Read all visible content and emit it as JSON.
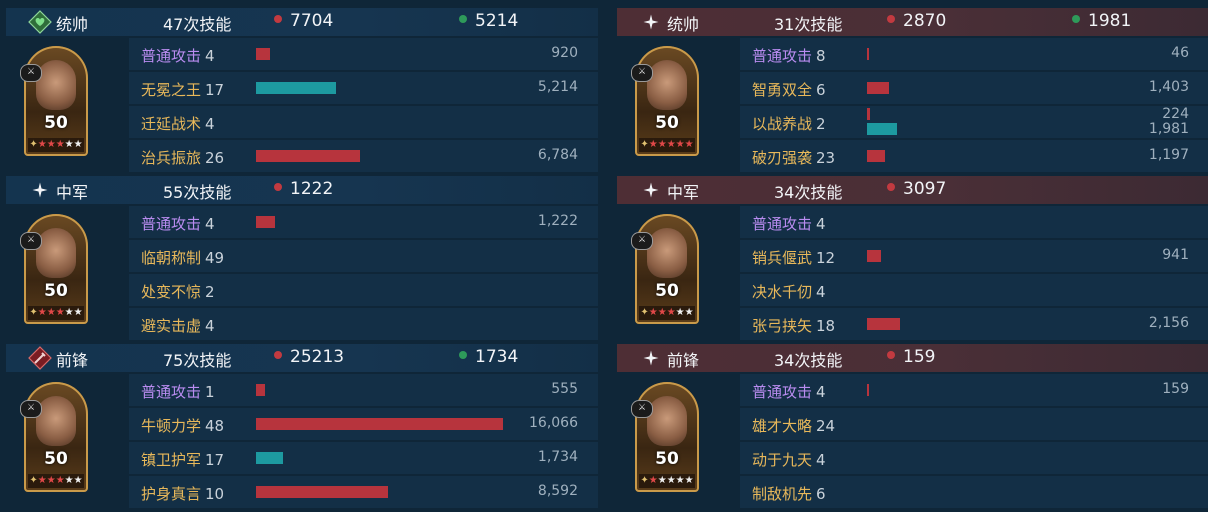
{
  "colors": {
    "damage": "#c23a40",
    "heal": "#2e9a5a",
    "basic_attack": "#b98cf0",
    "skill": "#e8b85a"
  },
  "left": [
    {
      "role": "统帅",
      "role_icon": "commander-heart-icon",
      "casts": "47次技能",
      "damage": "7704",
      "heal": "5214",
      "level": "50",
      "stars": {
        "red": 3,
        "white": 2
      },
      "skills": [
        {
          "name": "普通攻击",
          "level": "4",
          "basic": true,
          "value": "920",
          "bar": {
            "type": "red",
            "value": 920
          }
        },
        {
          "name": "无冕之王",
          "level": "17",
          "basic": false,
          "value": "5,214",
          "bar": {
            "type": "teal",
            "value": 5214
          }
        },
        {
          "name": "迁延战术",
          "level": "4",
          "basic": false,
          "value": "",
          "bar": null
        },
        {
          "name": "治兵振旅",
          "level": "26",
          "basic": false,
          "value": "6,784",
          "bar": {
            "type": "red",
            "value": 6784
          }
        }
      ]
    },
    {
      "role": "中军",
      "role_icon": "sparkle-icon",
      "casts": "55次技能",
      "damage": "1222",
      "heal": "",
      "level": "50",
      "stars": {
        "red": 3,
        "white": 2
      },
      "skills": [
        {
          "name": "普通攻击",
          "level": "4",
          "basic": true,
          "value": "1,222",
          "bar": {
            "type": "red",
            "value": 1222
          }
        },
        {
          "name": "临朝称制",
          "level": "49",
          "basic": false,
          "value": "",
          "bar": null
        },
        {
          "name": "处变不惊",
          "level": "2",
          "basic": false,
          "value": "",
          "bar": null
        },
        {
          "name": "避实击虚",
          "level": "4",
          "basic": false,
          "value": "",
          "bar": null
        }
      ]
    },
    {
      "role": "前锋",
      "role_icon": "vanguard-sword-icon",
      "casts": "75次技能",
      "damage": "25213",
      "heal": "1734",
      "level": "50",
      "stars": {
        "red": 3,
        "white": 2
      },
      "skills": [
        {
          "name": "普通攻击",
          "level": "1",
          "basic": true,
          "value": "555",
          "bar": {
            "type": "red",
            "value": 555
          }
        },
        {
          "name": "牛顿力学",
          "level": "48",
          "basic": false,
          "value": "16,066",
          "bar": {
            "type": "red",
            "value": 16066
          }
        },
        {
          "name": "镇卫护军",
          "level": "17",
          "basic": false,
          "value": "1,734",
          "bar": {
            "type": "teal",
            "value": 1734
          }
        },
        {
          "name": "护身真言",
          "level": "10",
          "basic": false,
          "value": "8,592",
          "bar": {
            "type": "red",
            "value": 8592
          }
        }
      ]
    }
  ],
  "right": [
    {
      "role": "统帅",
      "role_icon": "sparkle-icon",
      "casts": "31次技能",
      "damage": "2870",
      "heal": "1981",
      "level": "50",
      "stars": {
        "red": 5,
        "white": 0
      },
      "skills": [
        {
          "name": "普通攻击",
          "level": "8",
          "basic": true,
          "value": "46",
          "bar": {
            "type": "red",
            "value": 46
          }
        },
        {
          "name": "智勇双全",
          "level": "6",
          "basic": false,
          "value": "1,403",
          "bar": {
            "type": "red",
            "value": 1403
          }
        },
        {
          "name": "以战养战",
          "level": "2",
          "basic": false,
          "value": "224",
          "value2": "1,981",
          "bar": {
            "type": "red",
            "value": 224
          },
          "bar2": {
            "type": "teal",
            "value": 1981
          }
        },
        {
          "name": "破刃强袭",
          "level": "23",
          "basic": false,
          "value": "1,197",
          "bar": {
            "type": "red",
            "value": 1197
          }
        }
      ]
    },
    {
      "role": "中军",
      "role_icon": "sparkle-icon",
      "casts": "34次技能",
      "damage": "3097",
      "heal": "",
      "level": "50",
      "stars": {
        "red": 3,
        "white": 2
      },
      "skills": [
        {
          "name": "普通攻击",
          "level": "4",
          "basic": true,
          "value": "",
          "bar": null
        },
        {
          "name": "销兵偃武",
          "level": "12",
          "basic": false,
          "value": "941",
          "bar": {
            "type": "red",
            "value": 941
          }
        },
        {
          "name": "决水千仞",
          "level": "4",
          "basic": false,
          "value": "",
          "bar": null
        },
        {
          "name": "张弓挟矢",
          "level": "18",
          "basic": false,
          "value": "2,156",
          "bar": {
            "type": "red",
            "value": 2156
          }
        }
      ]
    },
    {
      "role": "前锋",
      "role_icon": "sparkle-icon",
      "casts": "34次技能",
      "damage": "159",
      "heal": "",
      "level": "50",
      "stars": {
        "red": 1,
        "white": 4
      },
      "skills": [
        {
          "name": "普通攻击",
          "level": "4",
          "basic": true,
          "value": "159",
          "bar": {
            "type": "red",
            "value": 159
          }
        },
        {
          "name": "雄才大略",
          "level": "24",
          "basic": false,
          "value": "",
          "bar": null
        },
        {
          "name": "动于九天",
          "level": "4",
          "basic": false,
          "value": "",
          "bar": null
        },
        {
          "name": "制敌机先",
          "level": "6",
          "basic": false,
          "value": "",
          "bar": null
        }
      ]
    }
  ]
}
